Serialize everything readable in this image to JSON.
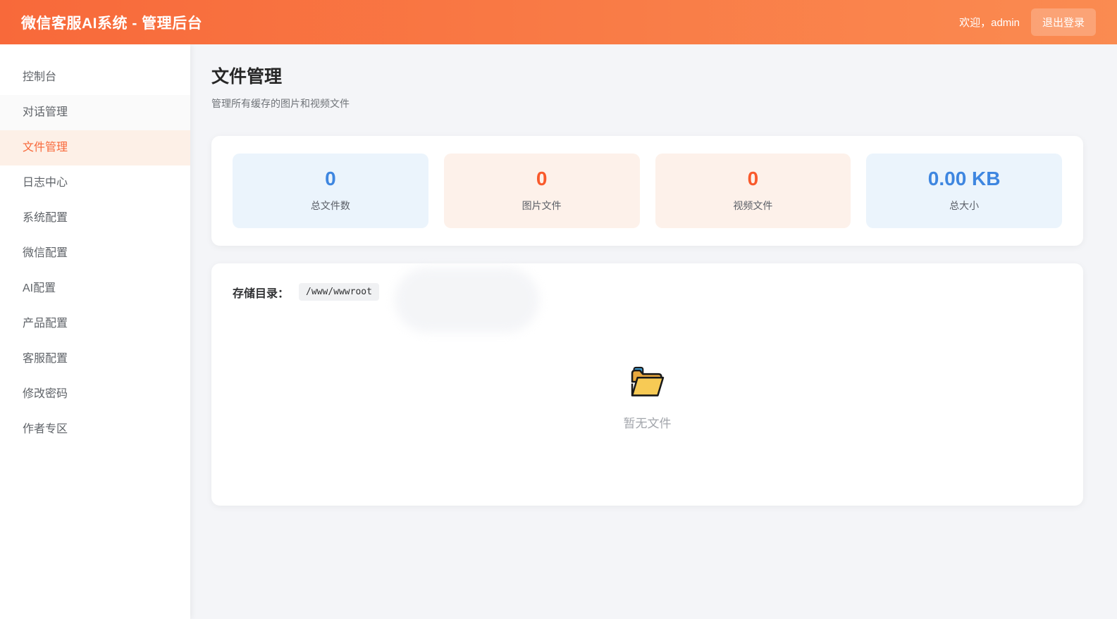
{
  "header": {
    "title": "微信客服AI系统 - 管理后台",
    "welcome": "欢迎，admin",
    "logout_label": "退出登录"
  },
  "sidebar": {
    "items": [
      {
        "label": "控制台",
        "active": false
      },
      {
        "label": "对话管理",
        "active": false
      },
      {
        "label": "文件管理",
        "active": true
      },
      {
        "label": "日志中心",
        "active": false
      },
      {
        "label": "系统配置",
        "active": false
      },
      {
        "label": "微信配置",
        "active": false
      },
      {
        "label": "AI配置",
        "active": false
      },
      {
        "label": "产品配置",
        "active": false
      },
      {
        "label": "客服配置",
        "active": false
      },
      {
        "label": "修改密码",
        "active": false
      },
      {
        "label": "作者专区",
        "active": false
      }
    ]
  },
  "page": {
    "title": "文件管理",
    "subtitle": "管理所有缓存的图片和视频文件"
  },
  "stats": [
    {
      "value": "0",
      "label": "总文件数",
      "theme": "blue"
    },
    {
      "value": "0",
      "label": "图片文件",
      "theme": "orange"
    },
    {
      "value": "0",
      "label": "视频文件",
      "theme": "orange"
    },
    {
      "value": "0.00 KB",
      "label": "总大小",
      "theme": "blue"
    }
  ],
  "storage": {
    "label": "存储目录：",
    "path": "/www/wwwroot"
  },
  "empty": {
    "icon": "open-folder-icon",
    "text": "暂无文件"
  },
  "colors": {
    "header_gradient_start": "#f8693a",
    "header_gradient_end": "#fa8b51",
    "active_nav_bg": "#fdf0e7",
    "active_nav_text": "#f8683a",
    "stat_blue_bg": "#ebf4fc",
    "stat_blue_text": "#3e86e0",
    "stat_orange_bg": "#fdf1ea",
    "stat_orange_text": "#f95a2c",
    "content_bg": "#f4f5f8"
  }
}
